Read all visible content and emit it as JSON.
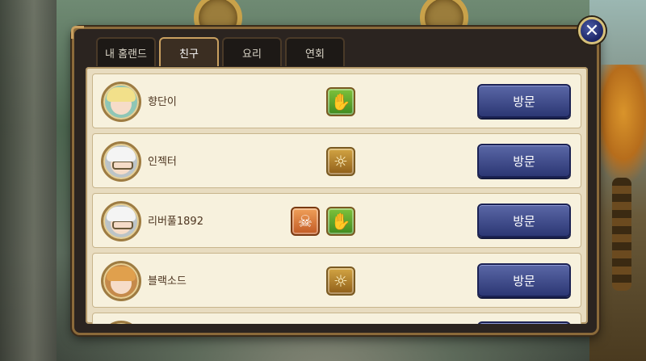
{
  "tabs": [
    {
      "label": "내 홈랜드",
      "active": false
    },
    {
      "label": "친구",
      "active": true
    },
    {
      "label": "요리",
      "active": false
    },
    {
      "label": "연회",
      "active": false
    }
  ],
  "close_icon": "✕",
  "friends": [
    {
      "name": "향단이",
      "avatar": "elf-character",
      "badges": [
        "green-hand-icon"
      ],
      "visit_label": "방문"
    },
    {
      "name": "인젝터",
      "avatar": "old-man-glasses",
      "badges": [
        "gold-spiral-icon"
      ],
      "visit_label": "방문"
    },
    {
      "name": "리버풀1892",
      "avatar": "old-man-glasses",
      "badges": [
        "orange-skull-icon",
        "green-hand-icon"
      ],
      "visit_label": "방문"
    },
    {
      "name": "블랙소드",
      "avatar": "brown-hair-character",
      "badges": [
        "gold-spiral-icon"
      ],
      "visit_label": "방문"
    },
    {
      "name": "",
      "avatar": "gold-character",
      "badges": [],
      "visit_label": ""
    }
  ],
  "colors": {
    "visit_button": "#2c3774",
    "tab_active_border": "#c9a060",
    "list_background": "#f7f1dd"
  }
}
